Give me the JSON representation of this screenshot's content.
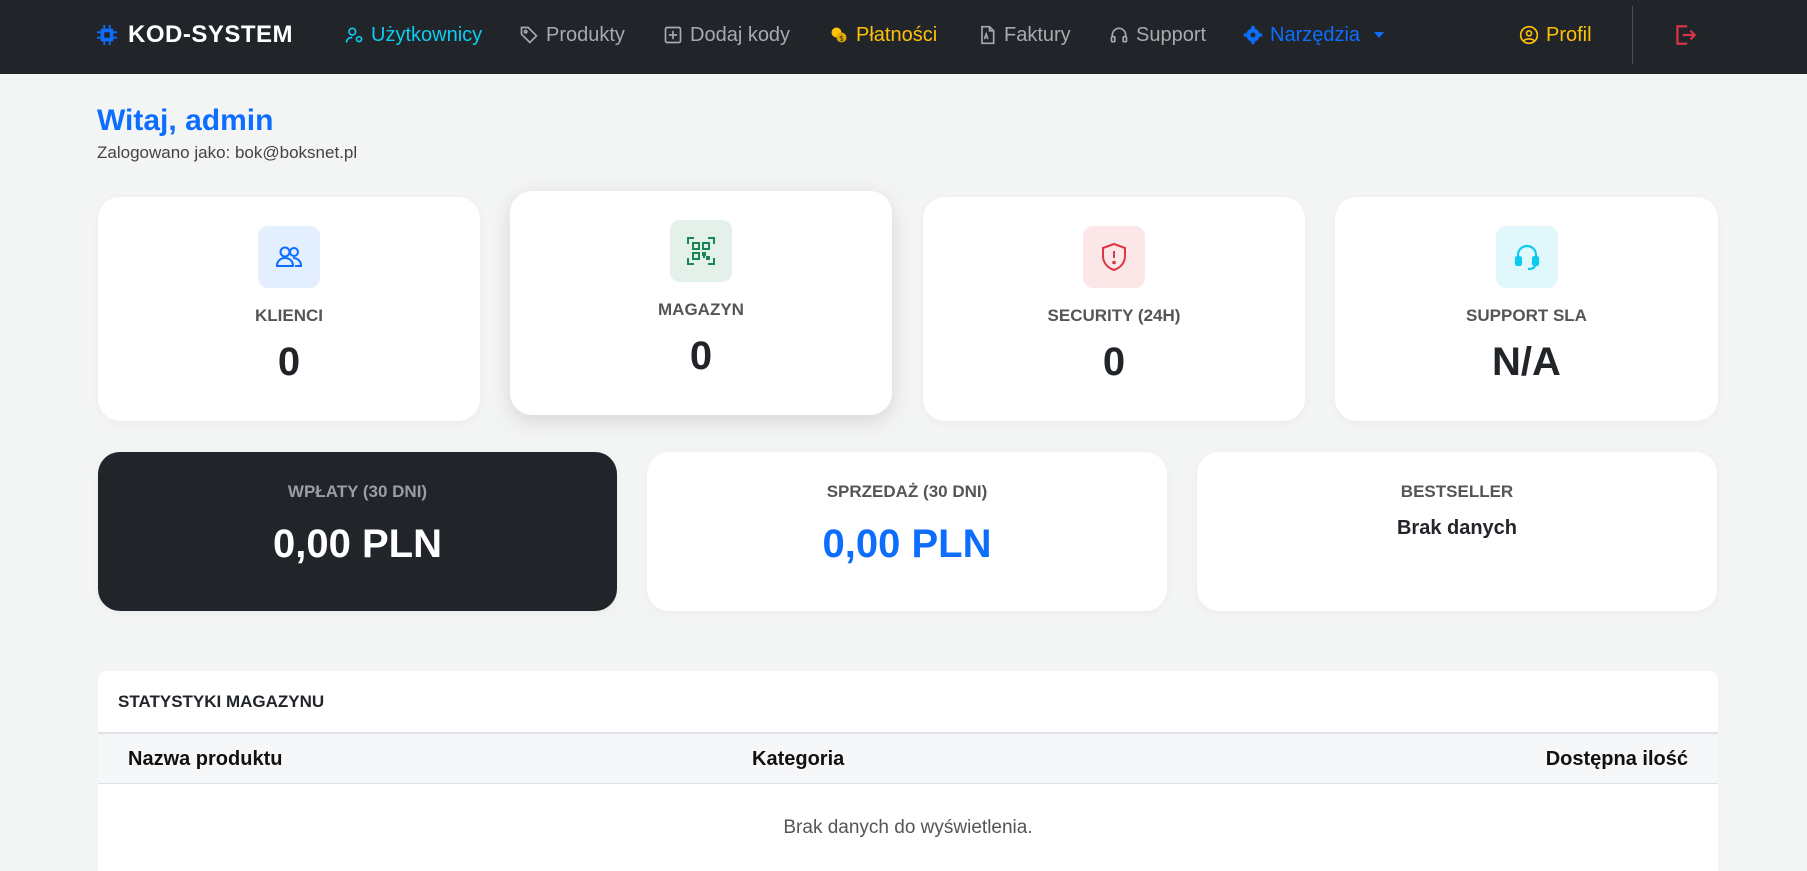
{
  "brand": {
    "name": "KOD-SYSTEM"
  },
  "nav": {
    "users": "Użytkownicy",
    "products": "Produkty",
    "add_codes": "Dodaj kody",
    "payments": "Płatności",
    "invoices": "Faktury",
    "support": "Support",
    "tools": "Narzędzia",
    "profile": "Profil"
  },
  "header": {
    "greeting": "Witaj, admin",
    "logged_in_as": "Zalogowano jako: bok@boksnet.pl"
  },
  "stats": [
    {
      "label": "KLIENCI",
      "value": "0",
      "icon": "users-icon"
    },
    {
      "label": "MAGAZYN",
      "value": "0",
      "icon": "qr-code-icon"
    },
    {
      "label": "SECURITY (24H)",
      "value": "0",
      "icon": "shield-exclamation-icon"
    },
    {
      "label": "SUPPORT SLA",
      "value": "N/A",
      "icon": "headset-icon"
    }
  ],
  "finance": {
    "deposits": {
      "label": "WPŁATY (30 DNI)",
      "value": "0,00 PLN"
    },
    "sales": {
      "label": "SPRZEDAŻ (30 DNI)",
      "value": "0,00 PLN"
    },
    "bestseller": {
      "label": "BESTSELLER",
      "value": "Brak danych"
    }
  },
  "warehouse_table": {
    "title": "STATYSTYKI MAGAZYNU",
    "columns": [
      "Nazwa produktu",
      "Kategoria",
      "Dostępna ilość"
    ],
    "empty_message": "Brak danych do wyświetlenia."
  },
  "colors": {
    "navbar": "#212529",
    "accent_blue": "#0d6efd",
    "cyan": "#0dcaf0",
    "warning": "#ffc107",
    "danger": "#dc3545",
    "success": "#198754"
  }
}
